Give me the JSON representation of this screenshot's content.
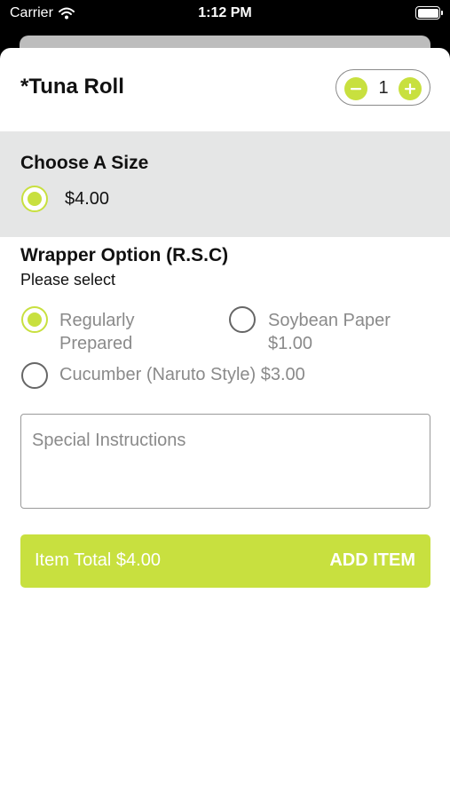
{
  "status_bar": {
    "carrier": "Carrier",
    "time": "1:12 PM"
  },
  "item": {
    "title": "*Tuna Roll",
    "quantity": "1"
  },
  "size_section": {
    "header": "Choose A Size",
    "options": [
      {
        "label": "$4.00",
        "selected": true
      }
    ]
  },
  "wrapper_section": {
    "header": "Wrapper Option (R.S.C)",
    "subtitle": "Please select",
    "options": [
      {
        "label": "Regularly Prepared",
        "selected": true
      },
      {
        "label": "Soybean Paper $1.00",
        "selected": false
      },
      {
        "label": "Cucumber (Naruto Style) $3.00",
        "selected": false
      }
    ]
  },
  "instructions": {
    "placeholder": "Special Instructions",
    "value": ""
  },
  "footer": {
    "total_label": "Item Total $4.00",
    "add_label": "ADD ITEM"
  },
  "colors": {
    "accent": "#c8e03f",
    "section_bg": "#e5e6e6",
    "muted_text": "#8a8a8a"
  },
  "icons": {
    "wifi": "wifi-icon",
    "battery": "battery-icon",
    "minus": "minus-icon",
    "plus": "plus-icon"
  }
}
